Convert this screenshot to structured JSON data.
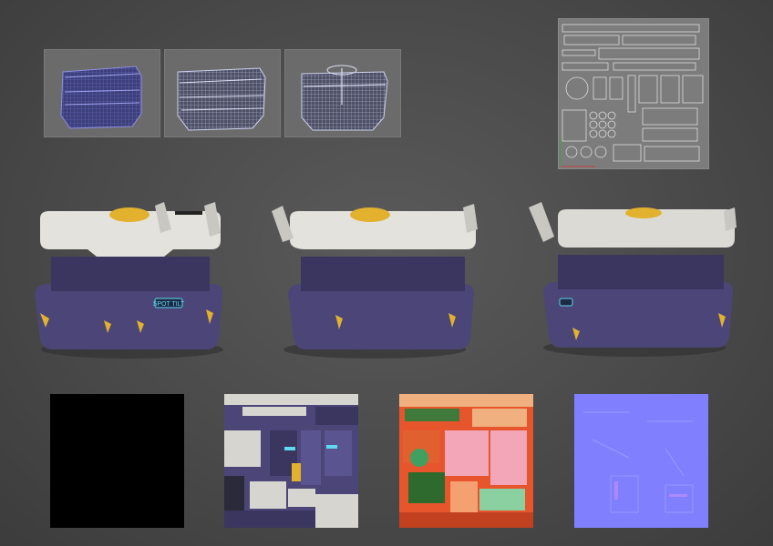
{
  "wireframe_views": [
    {
      "name": "front",
      "line_color": "#6d72c8"
    },
    {
      "name": "three-quarter",
      "line_color": "#a9b0d6"
    },
    {
      "name": "back",
      "line_color": "#a9b0d6"
    }
  ],
  "uv_layout": {
    "name": "uv-map"
  },
  "renders": [
    {
      "name": "front-view",
      "panel_text": "SPOT TILT"
    },
    {
      "name": "side-view"
    },
    {
      "name": "rear-view"
    }
  ],
  "texture_maps": [
    {
      "name": "ambient-occlusion",
      "color": "#000000"
    },
    {
      "name": "albedo"
    },
    {
      "name": "id-map"
    },
    {
      "name": "normal-map",
      "color": "#8080ff"
    }
  ],
  "colors": {
    "body": "#4b4677",
    "body_dark": "#3a3660",
    "lid": "#e4e2dd",
    "accent": "#e2b12e",
    "glow": "#5fd8f0",
    "background": "#4d4d4d"
  }
}
